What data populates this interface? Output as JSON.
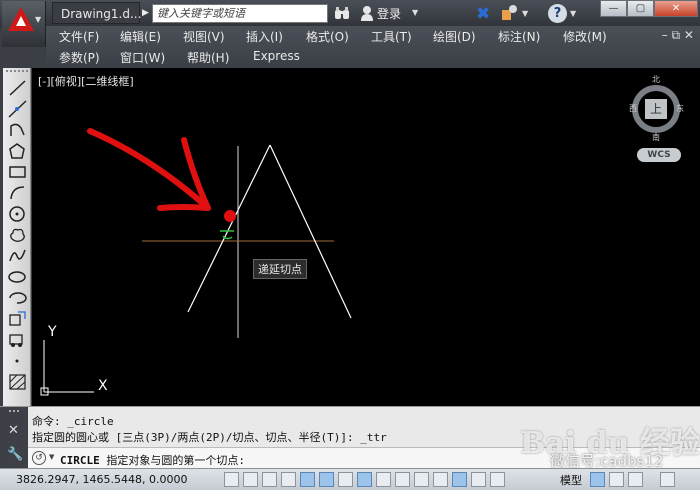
{
  "titlebar": {
    "doc_tab": "Drawing1.d...",
    "search_placeholder": "键入关键字或短语",
    "login": "登录"
  },
  "menu": {
    "row1": [
      "文件(F)",
      "编辑(E)",
      "视图(V)",
      "插入(I)",
      "格式(O)",
      "工具(T)",
      "绘图(D)",
      "标注(N)",
      "修改(M)"
    ],
    "row2": [
      "参数(P)",
      "窗口(W)",
      "帮助(H)",
      "Express"
    ]
  },
  "viewport": {
    "label": "[-][俯视][二维线框]",
    "viewcube": {
      "north": "北",
      "south": "南",
      "east": "东",
      "west": "西",
      "top_face": "上"
    },
    "wcs": "WCS",
    "tooltip": "递延切点",
    "ucs_x": "X",
    "ucs_y": "Y"
  },
  "command": {
    "history": [
      "命令: _circle",
      "指定圆的圆心或 [三点(3P)/两点(2P)/切点、切点、半径(T)]: _ttr"
    ],
    "input_keyword": "CIRCLE",
    "input_text": "指定对象与圆的第一个切点:"
  },
  "statusbar": {
    "coords": "3826.2947, 1465.5448, 0.0000",
    "model": "模型"
  },
  "watermark": {
    "logo": "Bai du 经验",
    "text": "微信号:cadbs12"
  },
  "colors": {
    "canvas_bg": "#000000",
    "annotation_red": "#e01010",
    "lines": "#ffffff"
  }
}
